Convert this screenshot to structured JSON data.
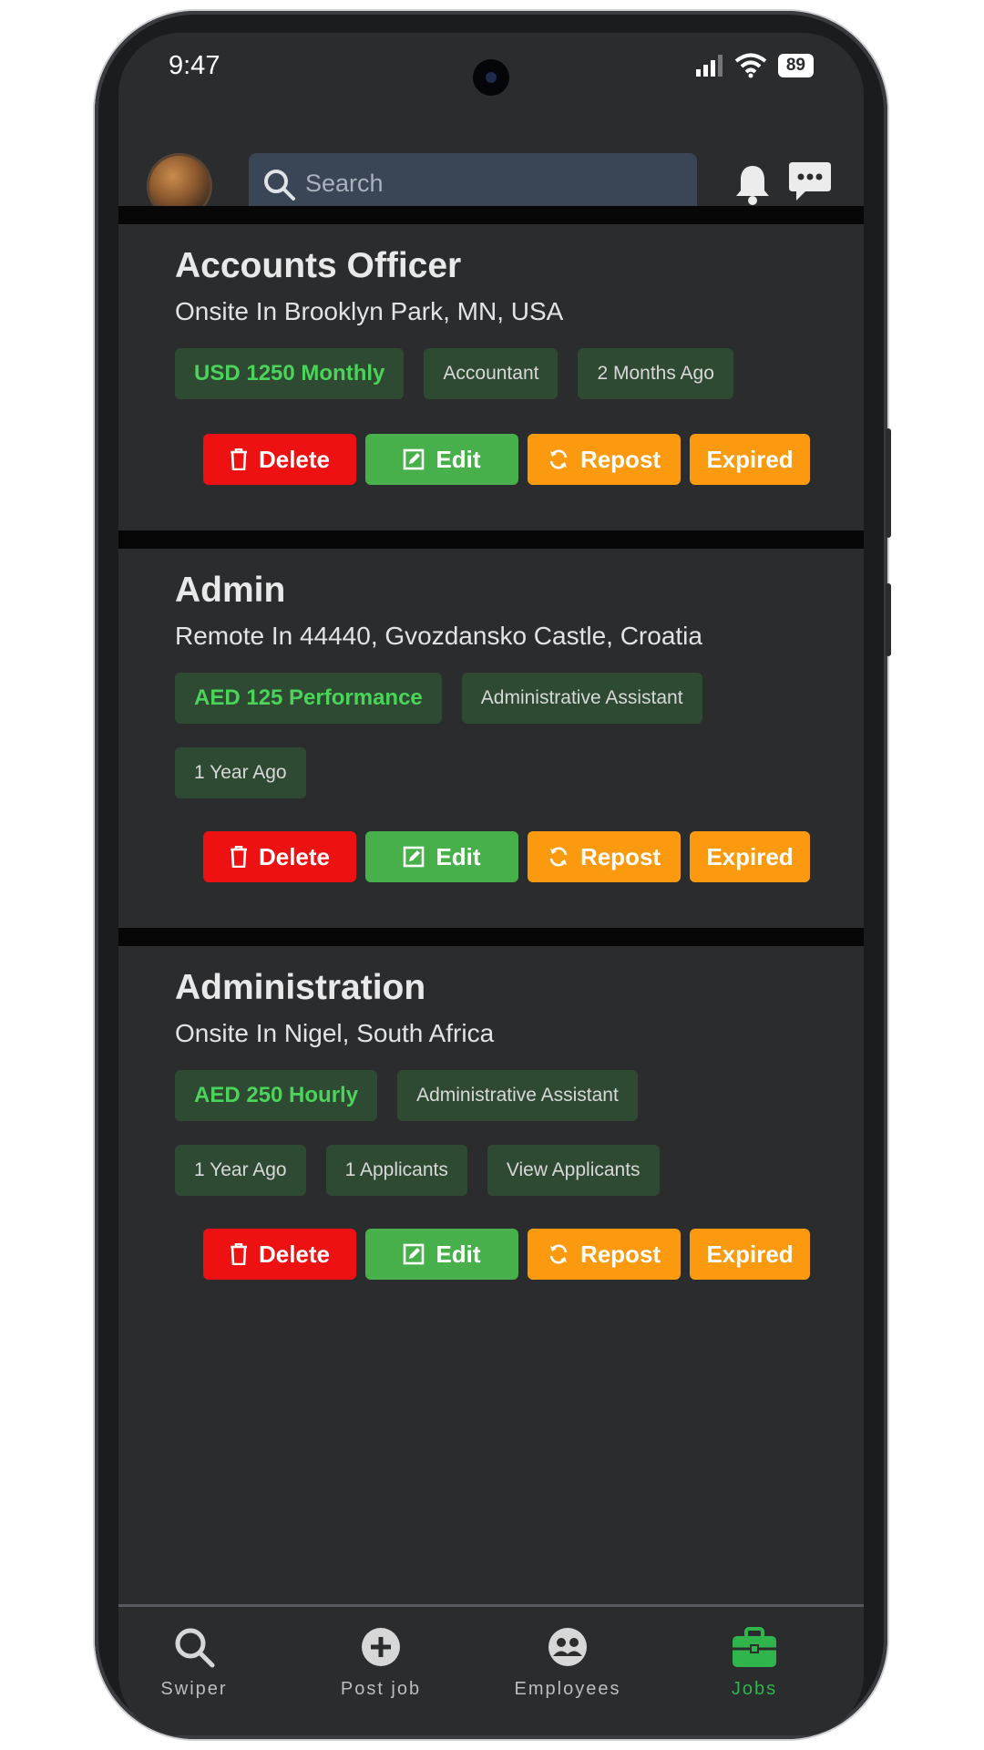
{
  "status_bar": {
    "time": "9:47",
    "battery": "89"
  },
  "header": {
    "search_placeholder": "Search"
  },
  "jobs": [
    {
      "title": "Accounts Officer",
      "location": "Onsite In Brooklyn Park, MN, USA",
      "salary": "USD 1250 Monthly",
      "category": "Accountant",
      "posted": "2 Months Ago"
    },
    {
      "title": "Admin",
      "location": "Remote In 44440, Gvozdansko Castle, Croatia",
      "salary": "AED 125 Performance",
      "category": "Administrative Assistant",
      "posted": "1 Year Ago"
    },
    {
      "title": "Administration",
      "location": "Onsite In Nigel, South Africa",
      "salary": "AED 250 Hourly",
      "category": "Administrative Assistant",
      "posted": "1 Year Ago",
      "applicants": "1 Applicants",
      "view_applicants": "View Applicants"
    }
  ],
  "actions": {
    "delete": "Delete",
    "edit": "Edit",
    "repost": "Repost",
    "expired": "Expired"
  },
  "nav": [
    {
      "label": "Swiper",
      "icon": "search-icon"
    },
    {
      "label": "Post job",
      "icon": "plus-circle-icon"
    },
    {
      "label": "Employees",
      "icon": "users-icon"
    },
    {
      "label": "Jobs",
      "icon": "briefcase-icon",
      "active": true
    }
  ],
  "colors": {
    "delete": "#ee1111",
    "edit": "#48b04a",
    "repost": "#fb9a0e",
    "expired": "#fb9a0e",
    "salary_text": "#4cd35a",
    "chip_bg": "#2e4a33",
    "active_nav": "#2fb54b"
  }
}
